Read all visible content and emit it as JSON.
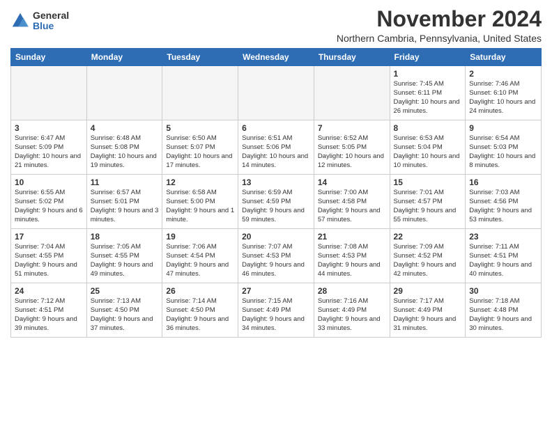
{
  "header": {
    "logo_general": "General",
    "logo_blue": "Blue",
    "month_title": "November 2024",
    "location": "Northern Cambria, Pennsylvania, United States"
  },
  "days_of_week": [
    "Sunday",
    "Monday",
    "Tuesday",
    "Wednesday",
    "Thursday",
    "Friday",
    "Saturday"
  ],
  "weeks": [
    [
      {
        "day": "",
        "empty": true
      },
      {
        "day": "",
        "empty": true
      },
      {
        "day": "",
        "empty": true
      },
      {
        "day": "",
        "empty": true
      },
      {
        "day": "",
        "empty": true
      },
      {
        "day": "1",
        "sunrise": "7:45 AM",
        "sunset": "6:11 PM",
        "daylight": "10 hours and 26 minutes."
      },
      {
        "day": "2",
        "sunrise": "7:46 AM",
        "sunset": "6:10 PM",
        "daylight": "10 hours and 24 minutes."
      }
    ],
    [
      {
        "day": "3",
        "sunrise": "6:47 AM",
        "sunset": "5:09 PM",
        "daylight": "10 hours and 21 minutes."
      },
      {
        "day": "4",
        "sunrise": "6:48 AM",
        "sunset": "5:08 PM",
        "daylight": "10 hours and 19 minutes."
      },
      {
        "day": "5",
        "sunrise": "6:50 AM",
        "sunset": "5:07 PM",
        "daylight": "10 hours and 17 minutes."
      },
      {
        "day": "6",
        "sunrise": "6:51 AM",
        "sunset": "5:06 PM",
        "daylight": "10 hours and 14 minutes."
      },
      {
        "day": "7",
        "sunrise": "6:52 AM",
        "sunset": "5:05 PM",
        "daylight": "10 hours and 12 minutes."
      },
      {
        "day": "8",
        "sunrise": "6:53 AM",
        "sunset": "5:04 PM",
        "daylight": "10 hours and 10 minutes."
      },
      {
        "day": "9",
        "sunrise": "6:54 AM",
        "sunset": "5:03 PM",
        "daylight": "10 hours and 8 minutes."
      }
    ],
    [
      {
        "day": "10",
        "sunrise": "6:55 AM",
        "sunset": "5:02 PM",
        "daylight": "9 hours and 6 minutes."
      },
      {
        "day": "11",
        "sunrise": "6:57 AM",
        "sunset": "5:01 PM",
        "daylight": "9 hours and 3 minutes."
      },
      {
        "day": "12",
        "sunrise": "6:58 AM",
        "sunset": "5:00 PM",
        "daylight": "9 hours and 1 minute."
      },
      {
        "day": "13",
        "sunrise": "6:59 AM",
        "sunset": "4:59 PM",
        "daylight": "9 hours and 59 minutes."
      },
      {
        "day": "14",
        "sunrise": "7:00 AM",
        "sunset": "4:58 PM",
        "daylight": "9 hours and 57 minutes."
      },
      {
        "day": "15",
        "sunrise": "7:01 AM",
        "sunset": "4:57 PM",
        "daylight": "9 hours and 55 minutes."
      },
      {
        "day": "16",
        "sunrise": "7:03 AM",
        "sunset": "4:56 PM",
        "daylight": "9 hours and 53 minutes."
      }
    ],
    [
      {
        "day": "17",
        "sunrise": "7:04 AM",
        "sunset": "4:55 PM",
        "daylight": "9 hours and 51 minutes."
      },
      {
        "day": "18",
        "sunrise": "7:05 AM",
        "sunset": "4:55 PM",
        "daylight": "9 hours and 49 minutes."
      },
      {
        "day": "19",
        "sunrise": "7:06 AM",
        "sunset": "4:54 PM",
        "daylight": "9 hours and 47 minutes."
      },
      {
        "day": "20",
        "sunrise": "7:07 AM",
        "sunset": "4:53 PM",
        "daylight": "9 hours and 46 minutes."
      },
      {
        "day": "21",
        "sunrise": "7:08 AM",
        "sunset": "4:53 PM",
        "daylight": "9 hours and 44 minutes."
      },
      {
        "day": "22",
        "sunrise": "7:09 AM",
        "sunset": "4:52 PM",
        "daylight": "9 hours and 42 minutes."
      },
      {
        "day": "23",
        "sunrise": "7:11 AM",
        "sunset": "4:51 PM",
        "daylight": "9 hours and 40 minutes."
      }
    ],
    [
      {
        "day": "24",
        "sunrise": "7:12 AM",
        "sunset": "4:51 PM",
        "daylight": "9 hours and 39 minutes."
      },
      {
        "day": "25",
        "sunrise": "7:13 AM",
        "sunset": "4:50 PM",
        "daylight": "9 hours and 37 minutes."
      },
      {
        "day": "26",
        "sunrise": "7:14 AM",
        "sunset": "4:50 PM",
        "daylight": "9 hours and 36 minutes."
      },
      {
        "day": "27",
        "sunrise": "7:15 AM",
        "sunset": "4:49 PM",
        "daylight": "9 hours and 34 minutes."
      },
      {
        "day": "28",
        "sunrise": "7:16 AM",
        "sunset": "4:49 PM",
        "daylight": "9 hours and 33 minutes."
      },
      {
        "day": "29",
        "sunrise": "7:17 AM",
        "sunset": "4:49 PM",
        "daylight": "9 hours and 31 minutes."
      },
      {
        "day": "30",
        "sunrise": "7:18 AM",
        "sunset": "4:48 PM",
        "daylight": "9 hours and 30 minutes."
      }
    ]
  ]
}
